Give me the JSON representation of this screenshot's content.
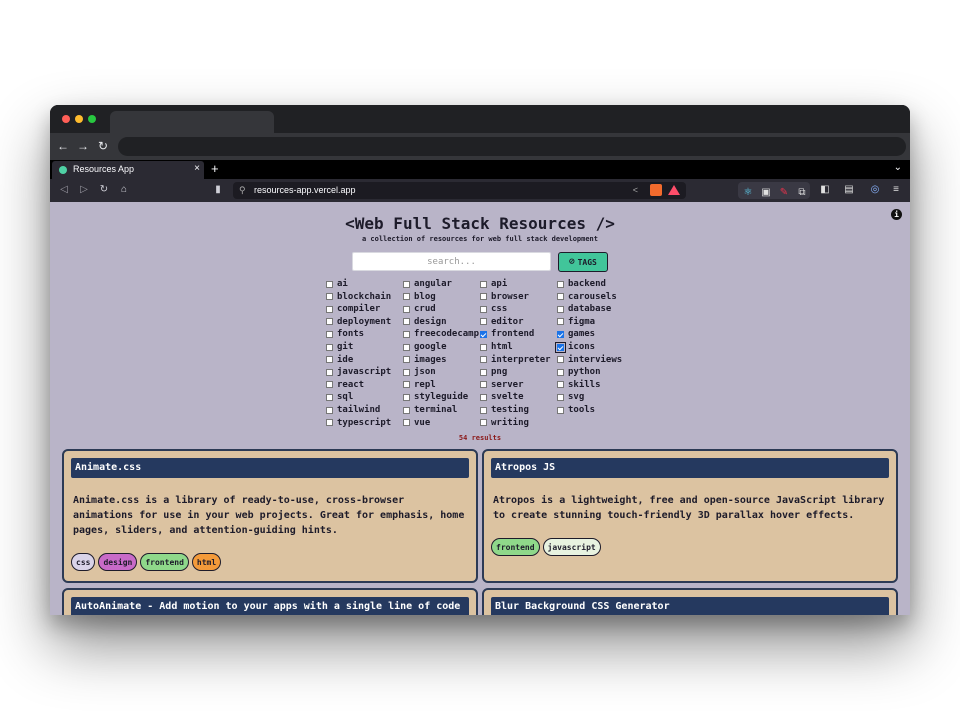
{
  "browser": {
    "tab_title": "Resources App",
    "tab_close": "×",
    "new_tab": "+",
    "tab_menu": "⌄",
    "url": "resources-app.vercel.app"
  },
  "page": {
    "title": "<Web Full Stack Resources />",
    "subtitle": "a collection of resources for web full stack development",
    "search_placeholder": "search...",
    "tags_button": "TAGS",
    "info_icon": "i",
    "results": "54 results"
  },
  "tags": [
    {
      "label": "ai",
      "checked": false
    },
    {
      "label": "angular",
      "checked": false
    },
    {
      "label": "api",
      "checked": false
    },
    {
      "label": "backend",
      "checked": false
    },
    {
      "label": "blockchain",
      "checked": false
    },
    {
      "label": "blog",
      "checked": false
    },
    {
      "label": "browser",
      "checked": false
    },
    {
      "label": "carousels",
      "checked": false
    },
    {
      "label": "compiler",
      "checked": false
    },
    {
      "label": "crud",
      "checked": false
    },
    {
      "label": "css",
      "checked": false
    },
    {
      "label": "database",
      "checked": false
    },
    {
      "label": "deployment",
      "checked": false
    },
    {
      "label": "design",
      "checked": false
    },
    {
      "label": "editor",
      "checked": false
    },
    {
      "label": "figma",
      "checked": false
    },
    {
      "label": "fonts",
      "checked": false
    },
    {
      "label": "freecodecamp",
      "checked": false
    },
    {
      "label": "frontend",
      "checked": true
    },
    {
      "label": "games",
      "checked": true
    },
    {
      "label": "git",
      "checked": false
    },
    {
      "label": "google",
      "checked": false
    },
    {
      "label": "html",
      "checked": false
    },
    {
      "label": "icons",
      "checked": true
    },
    {
      "label": "ide",
      "checked": false
    },
    {
      "label": "images",
      "checked": false
    },
    {
      "label": "interpreter",
      "checked": false
    },
    {
      "label": "interviews",
      "checked": false
    },
    {
      "label": "javascript",
      "checked": false
    },
    {
      "label": "json",
      "checked": false
    },
    {
      "label": "png",
      "checked": false
    },
    {
      "label": "python",
      "checked": false
    },
    {
      "label": "react",
      "checked": false
    },
    {
      "label": "repl",
      "checked": false
    },
    {
      "label": "server",
      "checked": false
    },
    {
      "label": "skills",
      "checked": false
    },
    {
      "label": "sql",
      "checked": false
    },
    {
      "label": "styleguide",
      "checked": false
    },
    {
      "label": "svelte",
      "checked": false
    },
    {
      "label": "svg",
      "checked": false
    },
    {
      "label": "tailwind",
      "checked": false
    },
    {
      "label": "terminal",
      "checked": false
    },
    {
      "label": "testing",
      "checked": false
    },
    {
      "label": "tools",
      "checked": false
    },
    {
      "label": "typescript",
      "checked": false
    },
    {
      "label": "vue",
      "checked": false
    },
    {
      "label": "writing",
      "checked": false
    }
  ],
  "tag_colors": {
    "css": "#d9d3e8",
    "design": "#c86ac8",
    "frontend": "#8fd88a",
    "html": "#f39a3a",
    "javascript": "#e8f3e0"
  },
  "cards": [
    {
      "title": "Animate.css",
      "description": "Animate.css is a library of ready-to-use, cross-browser animations for use in your web projects. Great for emphasis, home pages, sliders, and attention-guiding hints.",
      "tags": [
        "css",
        "design",
        "frontend",
        "html"
      ]
    },
    {
      "title": "Atropos JS",
      "description": "Atropos is a lightweight, free and open-source JavaScript library to create stunning touch-friendly 3D parallax hover effects.",
      "tags": [
        "frontend",
        "javascript"
      ]
    },
    {
      "title": "AutoAnimate - Add motion to your apps with a single line of code",
      "description": "",
      "tags": []
    },
    {
      "title": "Blur Background CSS Generator",
      "description": "",
      "tags": []
    }
  ]
}
